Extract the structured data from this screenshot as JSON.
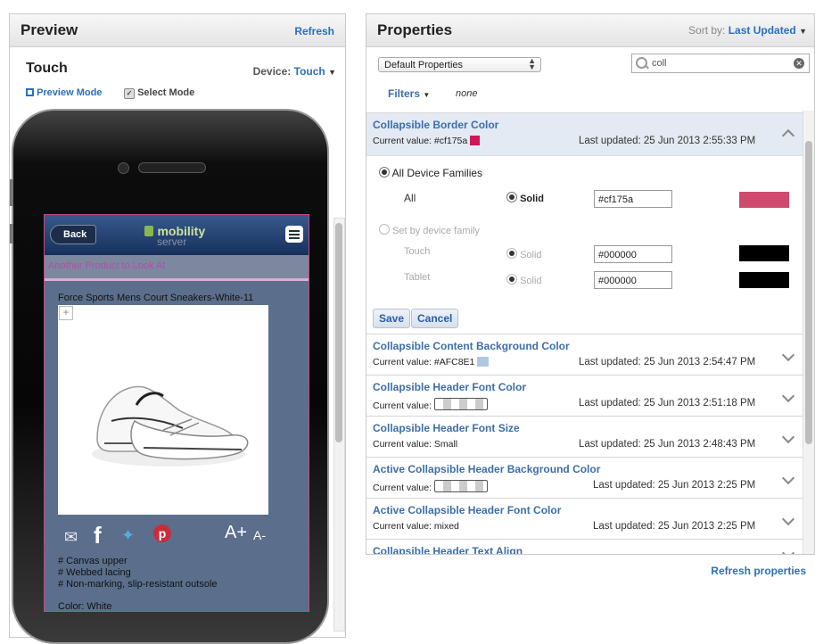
{
  "preview": {
    "title": "Preview",
    "refresh": "Refresh",
    "device_name": "Touch",
    "device_label": "Device:",
    "device_value": "Touch",
    "preview_mode": "Preview Mode",
    "select_mode": "Select Mode"
  },
  "phone": {
    "back": "Back",
    "logo_main": "mobility",
    "logo_sub": "server",
    "subheader": "Another Product to Look At",
    "product_title": "Force Sports Mens Court Sneakers-White-11",
    "font_up": "A+",
    "font_down": "A-",
    "features": [
      "# Canvas upper",
      "# Webbed lacing",
      "# Non-marking, slip-resistant outsole"
    ],
    "color": "Color: White"
  },
  "properties": {
    "title": "Properties",
    "sort_label": "Sort by:",
    "sort_value": "Last Updated",
    "dropdown_value": "Default Properties",
    "search_value": "coll",
    "filters_label": "Filters",
    "filters_value": "none",
    "save": "Save",
    "cancel": "Cancel",
    "refresh_properties": "Refresh properties",
    "expanded": {
      "name": "Collapsible Border Color",
      "current": "Current value: #cf175a",
      "swatch": "#cf175a",
      "updated": "Last updated: 25 Jun 2013 2:55:33 PM",
      "all_families": "All Device Families",
      "all_label": "All",
      "solid": "Solid",
      "all_hex": "#cf175a",
      "by_family": "Set by device family",
      "touch_label": "Touch",
      "tablet_label": "Tablet",
      "touch_hex": "#000000",
      "tablet_hex": "#000000",
      "touch_swatch": "#000000",
      "tablet_swatch": "#000000"
    },
    "items": [
      {
        "name": "Collapsible Content Background Color",
        "current": "Current value: #AFC8E1",
        "swatch": "#AFC8E1",
        "updated": "Last updated: 25 Jun 2013 2:54:47 PM"
      },
      {
        "name": "Collapsible Header Font Color",
        "current": "Current value:",
        "updated": "Last updated: 25 Jun 2013 2:51:18 PM"
      },
      {
        "name": "Collapsible Header Font Size",
        "current": "Current value: Small",
        "updated": "Last updated: 25 Jun 2013 2:48:43 PM"
      },
      {
        "name": "Active Collapsible Header Background Color",
        "current": "Current value:",
        "updated": "Last updated: 25 Jun 2013 2:25 PM"
      },
      {
        "name": "Active Collapsible Header Font Color",
        "current": "Current value: mixed",
        "updated": "Last updated: 25 Jun 2013 2:25 PM"
      },
      {
        "name": "Collapsible Header Text Align"
      }
    ]
  }
}
